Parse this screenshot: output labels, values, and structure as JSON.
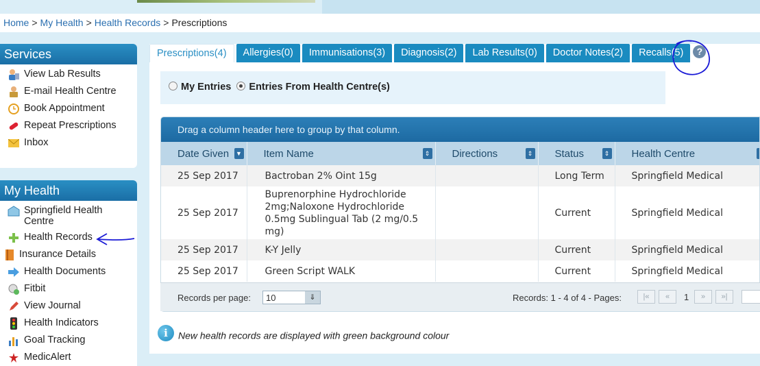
{
  "breadcrumb": {
    "items": [
      "Home",
      "My Health",
      "Health Records"
    ],
    "separator": ">",
    "current": "Prescriptions"
  },
  "services": {
    "title": "Services",
    "items": [
      {
        "label": "View Lab Results",
        "icon": "lab-results-icon"
      },
      {
        "label": "E-mail Health Centre",
        "icon": "email-doctor-icon"
      },
      {
        "label": "Book Appointment",
        "icon": "clock-icon"
      },
      {
        "label": "Repeat Prescriptions",
        "icon": "pill-icon"
      },
      {
        "label": "Inbox",
        "icon": "envelope-icon"
      }
    ]
  },
  "myhealth": {
    "title": "My Health",
    "items": [
      {
        "label": "Springfield Health Centre",
        "icon": "building-icon"
      },
      {
        "label": "Health Records",
        "icon": "plus-icon"
      },
      {
        "label": "Insurance Details",
        "icon": "book-icon"
      },
      {
        "label": "Health Documents",
        "icon": "arrow-right-icon"
      },
      {
        "label": "Fitbit",
        "icon": "fitbit-icon"
      },
      {
        "label": "View Journal",
        "icon": "pencil-icon"
      },
      {
        "label": "Health Indicators",
        "icon": "traffic-light-icon"
      },
      {
        "label": "Goal Tracking",
        "icon": "bar-chart-icon"
      },
      {
        "label": "MedicAlert",
        "icon": "medicalert-icon"
      }
    ]
  },
  "tabs": [
    {
      "label": "Prescriptions(4)",
      "active": true
    },
    {
      "label": "Allergies(0)"
    },
    {
      "label": "Immunisations(3)"
    },
    {
      "label": "Diagnosis(2)"
    },
    {
      "label": "Lab Results(0)"
    },
    {
      "label": "Doctor Notes(2)"
    },
    {
      "label": "Recalls(5)"
    }
  ],
  "help_label": "?",
  "filter": {
    "option1": "My Entries",
    "option2": "Entries From Health Centre(s)",
    "selected": "option2"
  },
  "grid": {
    "grouping_hint": "Drag a column header here to group by that column.",
    "columns": [
      "Date Given",
      "Item Name",
      "Directions",
      "Status",
      "Health Centre"
    ],
    "rows": [
      {
        "date": "25 Sep 2017",
        "item": "Bactroban 2% Oint 15g",
        "directions": "",
        "status": "Long Term",
        "centre": "Springfield Medical"
      },
      {
        "date": "25 Sep 2017",
        "item": "Buprenorphine Hydrochloride 2mg;Naloxone Hydrochloride 0.5mg Sublingual Tab (2 mg/0.5 mg)",
        "directions": "",
        "status": "Current",
        "centre": "Springfield Medical"
      },
      {
        "date": "25 Sep 2017",
        "item": "K-Y Jelly",
        "directions": "",
        "status": "Current",
        "centre": "Springfield Medical"
      },
      {
        "date": "25 Sep 2017",
        "item": "Green Script WALK",
        "directions": "",
        "status": "Current",
        "centre": "Springfield Medical"
      }
    ]
  },
  "pager": {
    "records_per_page_label": "Records per page:",
    "records_per_page": "10",
    "info": "Records: 1 - 4 of 4 - Pages:",
    "current_page": "1"
  },
  "note": "New health records are displayed with green background colour",
  "colors": {
    "tab": "#1a8bc0",
    "header": "#1d6aa2",
    "annotation": "#1a1ad6"
  }
}
